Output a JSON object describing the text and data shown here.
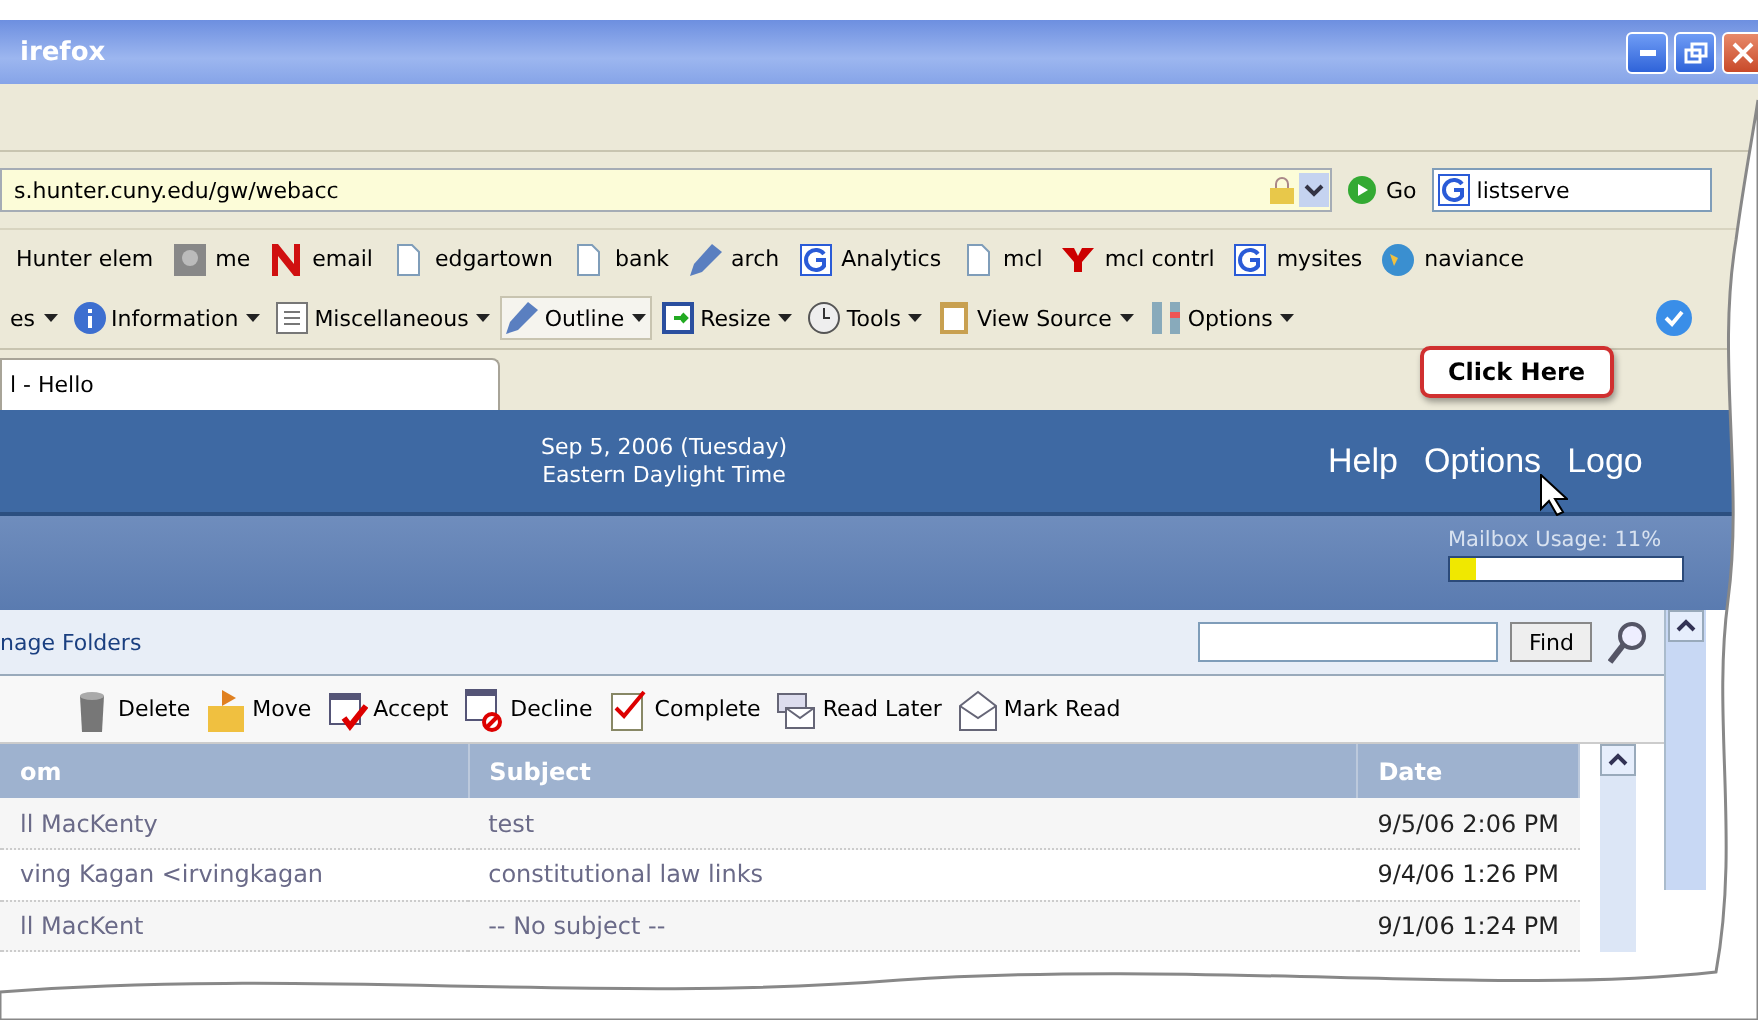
{
  "window": {
    "title": "irefox"
  },
  "address_bar": {
    "url": "s.hunter.cuny.edu/gw/webacc",
    "go": "Go",
    "search_value": "listserve"
  },
  "bookmarks": [
    {
      "label": "Hunter elem"
    },
    {
      "label": "me"
    },
    {
      "label": "email"
    },
    {
      "label": "edgartown"
    },
    {
      "label": "bank"
    },
    {
      "label": "arch"
    },
    {
      "label": "Analytics"
    },
    {
      "label": "mcl"
    },
    {
      "label": "mcl contrl"
    },
    {
      "label": "mysites"
    },
    {
      "label": "naviance"
    }
  ],
  "dev_toolbar": [
    {
      "label": "es"
    },
    {
      "label": "Information"
    },
    {
      "label": "Miscellaneous"
    },
    {
      "label": "Outline"
    },
    {
      "label": "Resize"
    },
    {
      "label": "Tools"
    },
    {
      "label": "View Source"
    },
    {
      "label": "Options"
    }
  ],
  "tabs": [
    {
      "title": "l - Hello",
      "selected": true
    }
  ],
  "header": {
    "date": "Sep 5, 2006 (Tuesday)",
    "timezone": "Eastern Daylight Time",
    "links": [
      "Help",
      "Options",
      "Logo"
    ]
  },
  "mailbox_usage": {
    "label": "Mailbox Usage: 11%",
    "level": 0.11
  },
  "folder_bar": {
    "link": "nage Folders",
    "find_button": "Find"
  },
  "actions": [
    "Delete",
    "Move",
    "Accept",
    "Decline",
    "Complete",
    "Read Later",
    "Mark Read"
  ],
  "table": {
    "columns": [
      "om",
      "Subject",
      "Date"
    ],
    "rows": [
      [
        "ll MacKenty",
        "test",
        "9/5/06 2:06 PM"
      ],
      [
        "ving Kagan <irvingkagan",
        "constitutional law links",
        "9/4/06 1:26 PM"
      ],
      [
        "ll MacKent",
        "-- No subject --",
        "9/1/06 1:24 PM"
      ]
    ]
  },
  "callout": {
    "text": "Click Here"
  }
}
